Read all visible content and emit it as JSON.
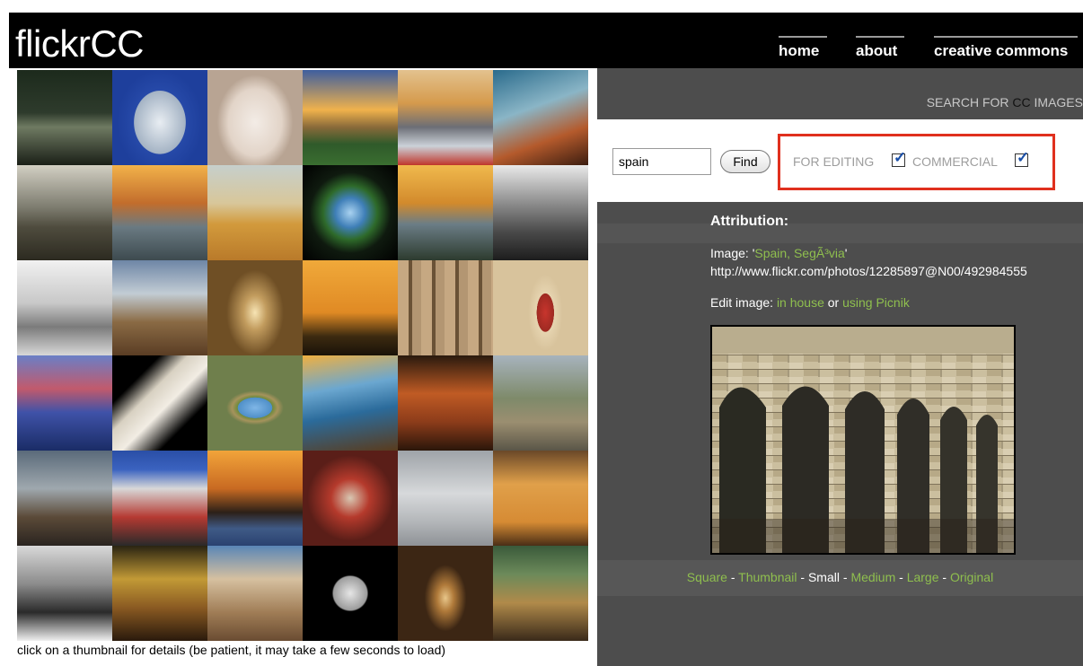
{
  "header": {
    "logo": "flickrCC",
    "nav": [
      {
        "label": "home"
      },
      {
        "label": "about"
      },
      {
        "label": "creative commons"
      }
    ]
  },
  "gallery": {
    "note": "click on a thumbnail for details (be patient, it may take a few seconds to load)"
  },
  "search": {
    "search_for_prefix": "SEARCH FOR ",
    "search_for_cc": "CC",
    "search_for_suffix": " IMAGES",
    "query_value": "spain",
    "find_label": "Find",
    "for_editing_label": "FOR EDITING",
    "for_editing_checked": true,
    "commercial_label": "COMMERCIAL",
    "commercial_checked": true
  },
  "attribution": {
    "title": "Attribution:",
    "image_prefix": "Image: '",
    "image_title": "Spain, SegÃ³via",
    "image_suffix": "'",
    "url": "http://www.flickr.com/photos/12285897@N00/492984555",
    "edit_prefix": "Edit image: ",
    "edit_in_house": "in house",
    "edit_or": " or ",
    "edit_picnik": "using Picnik"
  },
  "sizes": {
    "square": "Square",
    "thumbnail": "Thumbnail",
    "small": "Small",
    "medium": "Medium",
    "large": "Large",
    "original": "Original",
    "sep": " - "
  },
  "colors": {
    "header_bg": "#000000",
    "panel_bg": "#4d4d4d",
    "link_green": "#8fbf4e",
    "highlight_red": "#e0301e"
  }
}
